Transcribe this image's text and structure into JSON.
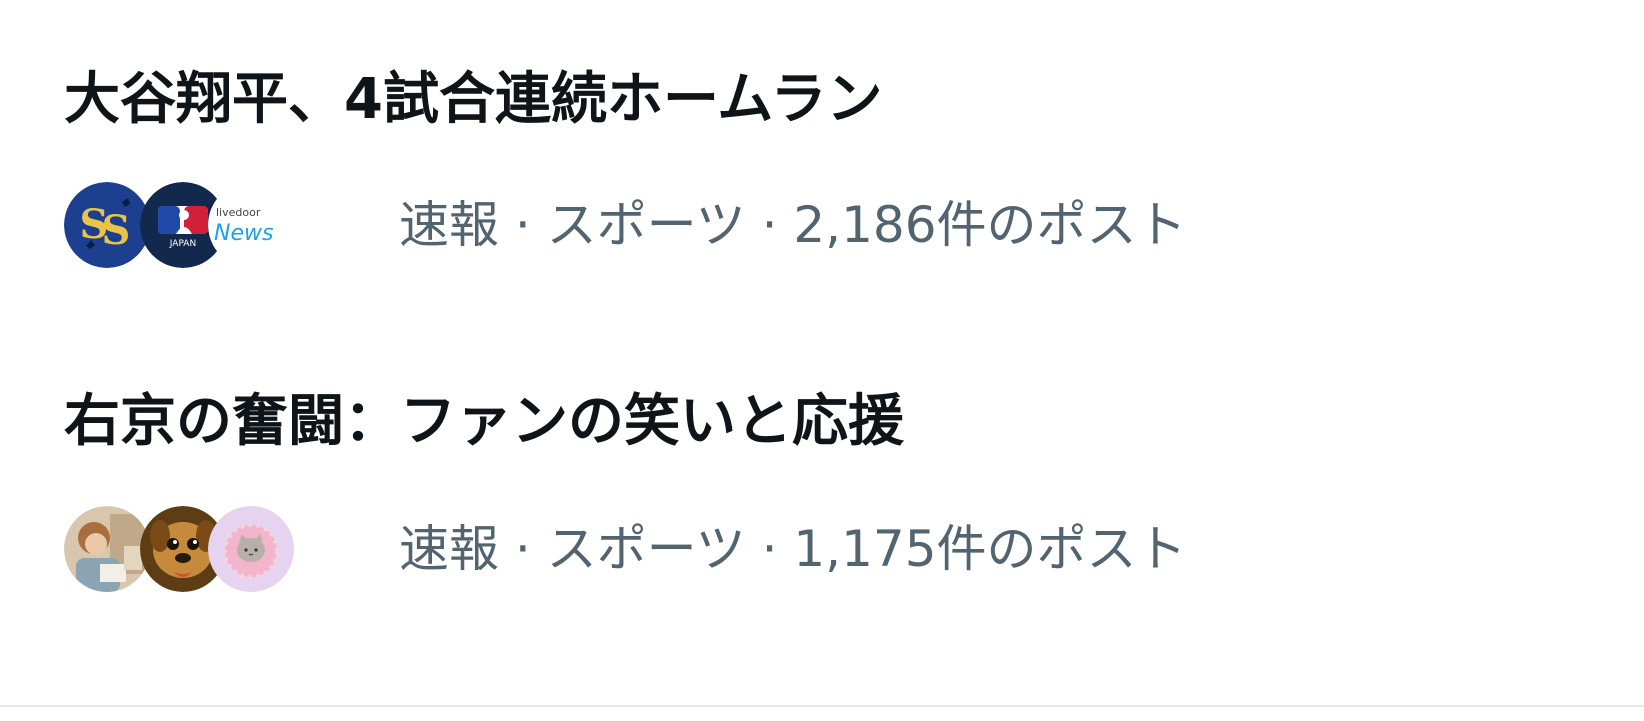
{
  "trends": [
    {
      "title": "大谷翔平、4試合連続ホームラン",
      "meta": "速報 · スポーツ · 2,186件のポスト",
      "avatars": [
        {
          "icon": "ss-team-logo-icon",
          "bg": "#1d3f8f",
          "fg": "#e8c547"
        },
        {
          "icon": "mlb-japan-logo-icon",
          "bg": "#13284d",
          "fg": "#ffffff"
        },
        {
          "icon": "livedoor-news-logo-icon",
          "bg": "#ffffff",
          "fg": "#1da1f2",
          "small_text": "livedoor",
          "big_text": "News"
        }
      ]
    },
    {
      "title": "右京の奮闘：ファンの笑いと応援",
      "meta": "速報 · スポーツ · 1,175件のポスト",
      "avatars": [
        {
          "icon": "user-photo-avatar-icon",
          "bg": "#c9b39a"
        },
        {
          "icon": "dog-avatar-icon",
          "bg": "#6b4a1e"
        },
        {
          "icon": "cat-donut-avatar-icon",
          "bg": "#e6d3ef"
        }
      ]
    }
  ],
  "colors": {
    "title": "#0f1419",
    "meta": "#536471",
    "divider": "#e4e8eb"
  }
}
